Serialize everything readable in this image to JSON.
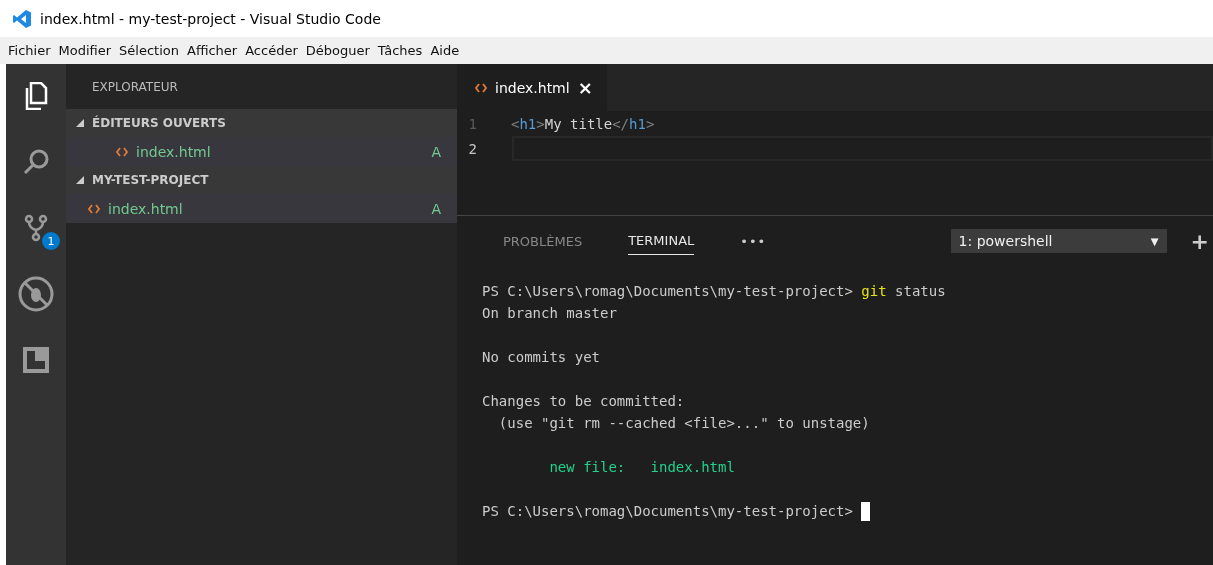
{
  "window": {
    "title": "index.html - my-test-project - Visual Studio Code"
  },
  "menu": [
    "Fichier",
    "Modifier",
    "Sélection",
    "Afficher",
    "Accéder",
    "Déboguer",
    "Tâches",
    "Aide"
  ],
  "activity_bar": [
    {
      "kind": "explorer",
      "selected": true
    },
    {
      "kind": "search",
      "selected": false
    },
    {
      "kind": "scm",
      "selected": false,
      "badge": "1"
    },
    {
      "kind": "debug",
      "selected": false
    },
    {
      "kind": "extensions",
      "selected": false
    }
  ],
  "sidebar": {
    "title": "EXPLORATEUR",
    "sections": [
      {
        "label": "ÉDITEURS OUVERTS",
        "expanded": true,
        "items": [
          {
            "name": "index.html",
            "status": "A",
            "selected": true,
            "nested": true
          }
        ]
      },
      {
        "label": "MY-TEST-PROJECT",
        "expanded": true,
        "items": [
          {
            "name": "index.html",
            "status": "A",
            "selected": true,
            "nested": false
          }
        ]
      }
    ]
  },
  "editor": {
    "tabs": [
      {
        "label": "index.html",
        "close": "×",
        "selected": true
      }
    ],
    "lines": [
      {
        "number": "1",
        "current": false,
        "tokens": [
          {
            "kind": "punct",
            "text": "<"
          },
          {
            "kind": "tag",
            "text": "h1"
          },
          {
            "kind": "punct",
            "text": ">"
          },
          {
            "kind": "text",
            "text": "My title"
          },
          {
            "kind": "punct",
            "text": "</"
          },
          {
            "kind": "tag",
            "text": "h1"
          },
          {
            "kind": "punct",
            "text": ">"
          }
        ]
      },
      {
        "number": "2",
        "current": true
      }
    ]
  },
  "panel": {
    "tabs": [
      {
        "label": "PROBLÈMES",
        "selected": false
      },
      {
        "label": "TERMINAL",
        "selected": true
      }
    ],
    "more": "•••",
    "terminal_select": {
      "value": "1: powershell",
      "arrow": "▼"
    },
    "add": "+",
    "terminal_blocks": [
      [
        {
          "tokens": [
            {
              "kind": "plain",
              "text": "PS C:\\Users\\romag\\Documents\\my-test-project> "
            },
            {
              "kind": "command",
              "text": "git"
            },
            {
              "kind": "plain",
              "text": " status"
            }
          ]
        },
        {
          "tokens": [
            {
              "kind": "plain",
              "text": "On branch master"
            }
          ]
        }
      ],
      [
        {
          "tokens": [
            {
              "kind": "plain",
              "text": "No commits yet"
            }
          ]
        }
      ],
      [
        {
          "tokens": [
            {
              "kind": "plain",
              "text": "Changes to be committed:"
            }
          ]
        },
        {
          "tokens": [
            {
              "kind": "plain",
              "text": "  (use \"git rm --cached <file>...\" to unstage)"
            }
          ]
        }
      ],
      [
        {
          "tokens": [
            {
              "kind": "added",
              "text": "        new file:   index.html"
            }
          ]
        }
      ],
      [
        {
          "tokens": [
            {
              "kind": "plain",
              "text": "PS C:\\Users\\romag\\Documents\\my-test-project> "
            }
          ],
          "cursor": true
        }
      ]
    ]
  }
}
